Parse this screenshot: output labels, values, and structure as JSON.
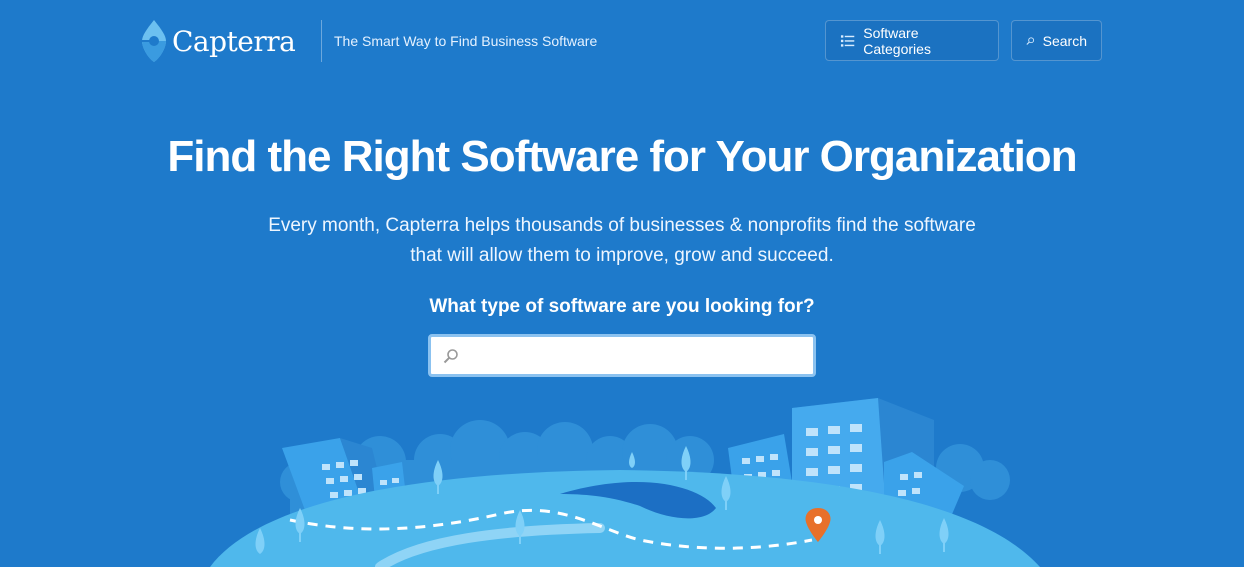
{
  "header": {
    "logo_text": "Capterra",
    "tagline": "The Smart Way to Find Business Software",
    "nav": {
      "categories_label": "Software Categories",
      "search_label": "Search"
    }
  },
  "hero": {
    "title": "Find the Right Software for Your Organization",
    "subtitle_line1": "Every month, Capterra helps thousands of businesses & nonprofits find the software",
    "subtitle_line2": "that will allow them to improve, grow and succeed.",
    "prompt": "What type of software are you looking for?",
    "search": {
      "value": "",
      "placeholder": ""
    }
  },
  "icons": {
    "logo": "capterra-logo-icon",
    "categories": "list-icon",
    "search": "magnifier-icon",
    "input_search": "magnifier-icon",
    "map_pin": "map-pin-icon"
  },
  "colors": {
    "background": "#1e7acb",
    "ground": "#4fb8ec",
    "pin": "#e8702a",
    "text": "#ffffff"
  }
}
